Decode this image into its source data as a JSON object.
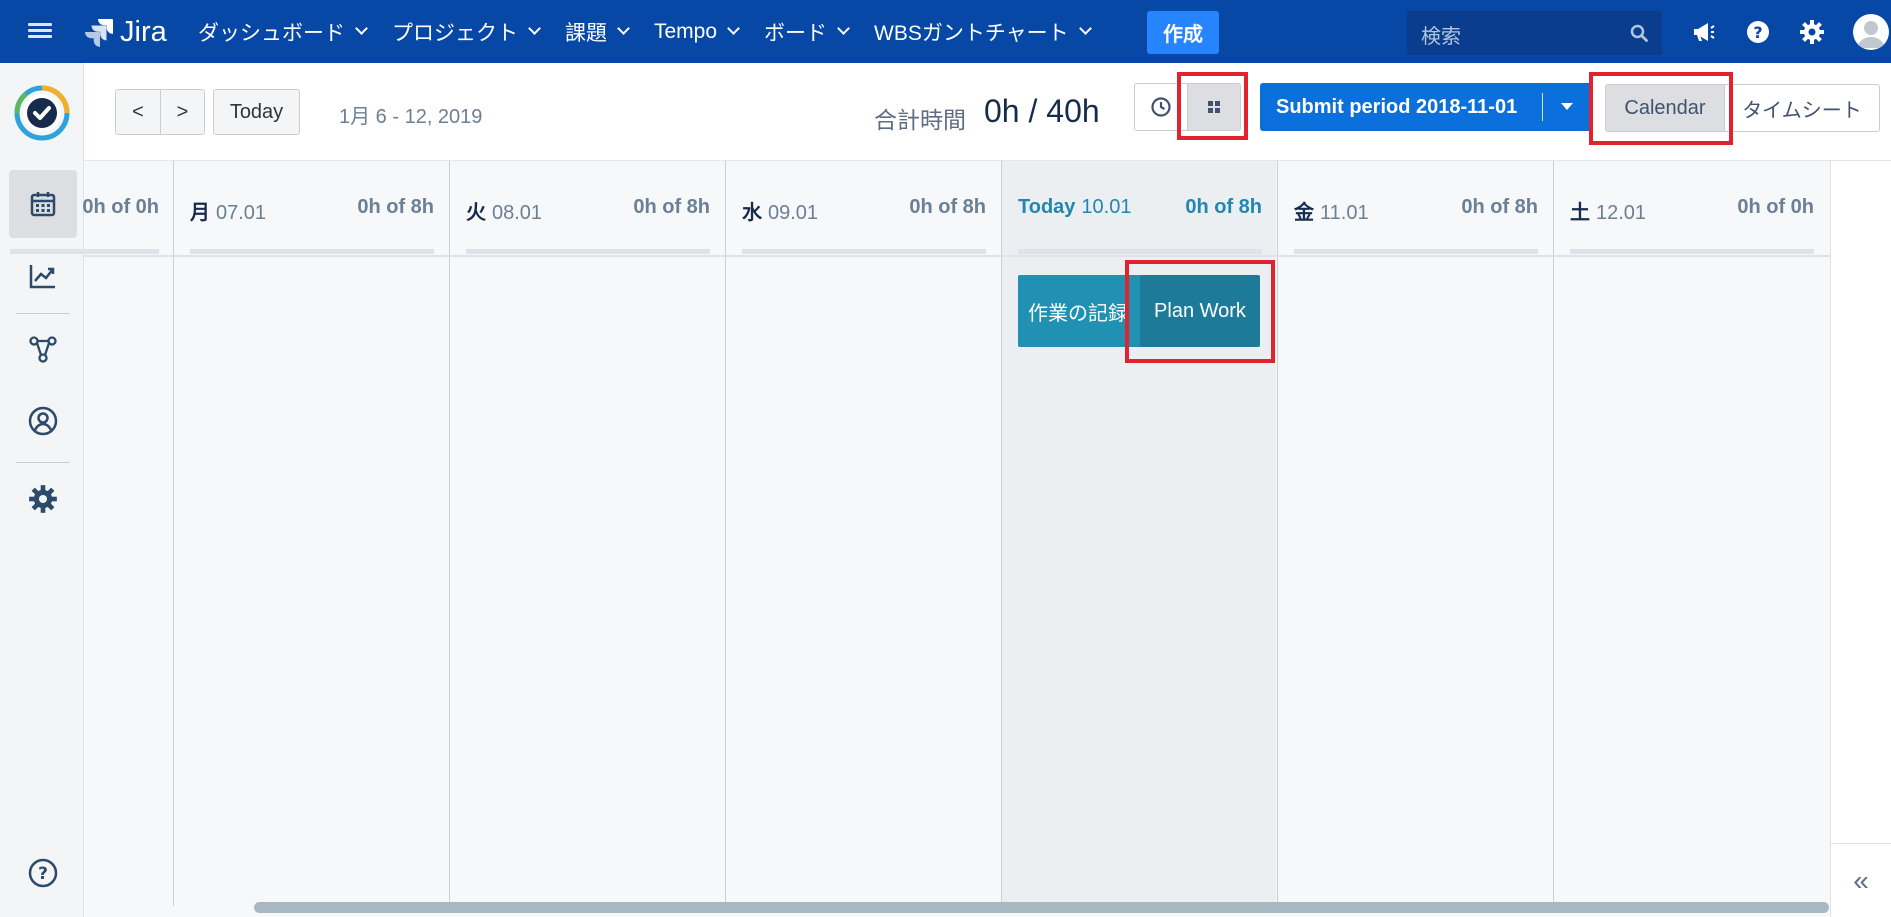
{
  "nav": {
    "logo_text": "Jira",
    "items": [
      {
        "label": "ダッシュボード"
      },
      {
        "label": "プロジェクト"
      },
      {
        "label": "課題"
      },
      {
        "label": "Tempo"
      },
      {
        "label": "ボード"
      },
      {
        "label": "WBSガントチャート"
      }
    ],
    "create_label": "作成",
    "search_placeholder": "検索"
  },
  "toolbar": {
    "prev_label": "<",
    "next_label": ">",
    "today_label": "Today",
    "date_range": "1月 6 - 12, 2019",
    "total_label": "合計時間",
    "total_value": "0h / 40h",
    "submit_label": "Submit period 2018-11-01",
    "view_calendar": "Calendar",
    "view_timesheet": "タイムシート"
  },
  "calendar": {
    "partial_hours": "0h of 0h",
    "days": [
      {
        "day": "月",
        "date": "07.01",
        "hours": "0h of 8h"
      },
      {
        "day": "火",
        "date": "08.01",
        "hours": "0h of 8h"
      },
      {
        "day": "水",
        "date": "09.01",
        "hours": "0h of 8h"
      },
      {
        "day": "Today",
        "date": "10.01",
        "hours": "0h of 8h"
      },
      {
        "day": "金",
        "date": "11.01",
        "hours": "0h of 8h"
      },
      {
        "day": "土",
        "date": "12.01",
        "hours": "0h of 0h"
      }
    ],
    "log_work_label": "作業の記録",
    "plan_work_label": "Plan Work"
  },
  "colors": {
    "nav_bg": "#0747a6",
    "create_bg": "#2684ff",
    "submit_bg": "#0b6fdc",
    "log_entry": "#2090b3",
    "plan_entry": "#1d7b99",
    "highlight": "#e0232e"
  },
  "icons": {
    "menu": "hamburger-icon",
    "search": "search-icon",
    "notifications": "megaphone-icon",
    "help": "help-icon",
    "settings": "gear-icon",
    "sidebar": [
      "calendar-icon",
      "chart-icon",
      "network-icon",
      "user-circle-icon",
      "gear-icon",
      "help-icon"
    ],
    "collapse": "double-chevron-left-icon"
  }
}
